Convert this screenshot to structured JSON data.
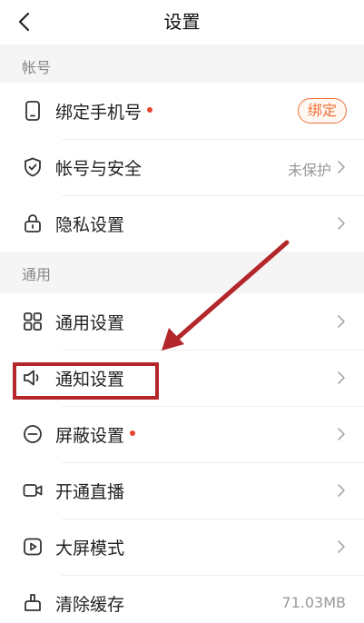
{
  "header": {
    "title": "设置",
    "back_icon": "chevron-left-icon"
  },
  "sections": {
    "account": {
      "title": "帐号"
    },
    "general": {
      "title": "通用"
    }
  },
  "rows": {
    "bind_phone": {
      "label": "绑定手机号",
      "icon": "phone-icon",
      "button_label": "绑定",
      "has_dot": true
    },
    "account_security": {
      "label": "帐号与安全",
      "icon": "shield-check-icon",
      "value": "未保护"
    },
    "privacy": {
      "label": "隐私设置",
      "icon": "lock-icon"
    },
    "general_settings": {
      "label": "通用设置",
      "icon": "grid-icon"
    },
    "notification": {
      "label": "通知设置",
      "icon": "speaker-icon"
    },
    "block": {
      "label": "屏蔽设置",
      "icon": "minus-circle-icon",
      "has_dot": true
    },
    "live": {
      "label": "开通直播",
      "icon": "video-camera-icon"
    },
    "bigscreen": {
      "label": "大屏模式",
      "icon": "play-square-icon"
    },
    "cache": {
      "label": "清除缓存",
      "icon": "broom-icon",
      "value": "71.03MB"
    }
  },
  "colors": {
    "accent": "#f0713a",
    "dot": "#e8452f",
    "annotation": "#b3262a",
    "background": "#f5f5f5"
  }
}
